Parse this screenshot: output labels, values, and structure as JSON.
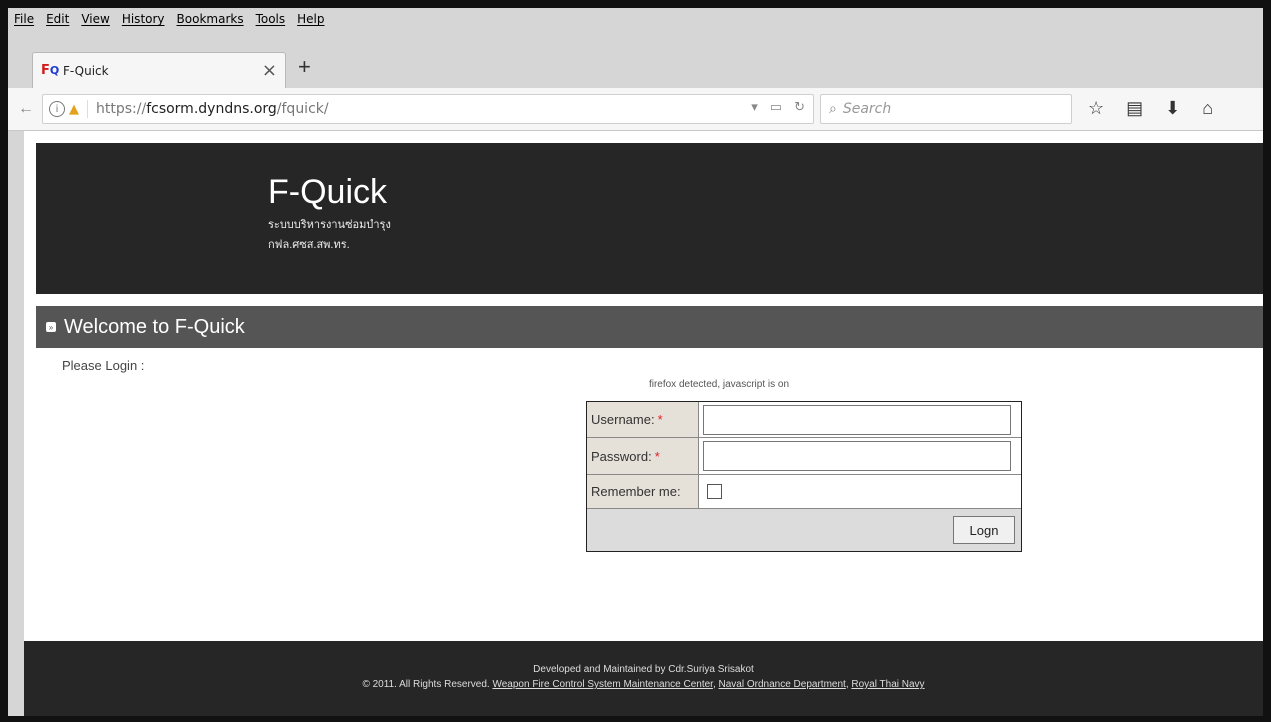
{
  "menu": [
    "File",
    "Edit",
    "View",
    "History",
    "Bookmarks",
    "Tools",
    "Help"
  ],
  "tab": {
    "title": "F-Quick",
    "favicon_text": "F",
    "favicon_q": "Q",
    "close_glyph": "×",
    "new_tab_glyph": "+"
  },
  "navbar": {
    "url_prefix": "https://",
    "url_domain": "fcsorm.dyndns.org",
    "url_path": "/fquick/",
    "search_placeholder": "Search"
  },
  "icons": {
    "back": "arrow-left-icon",
    "info": "info-icon",
    "lock": "warning-lock-icon",
    "reader": "reader-view-icon",
    "reload": "reload-icon",
    "search": "search-icon",
    "bookmark": "star-icon",
    "library": "library-icon",
    "download": "download-icon",
    "home": "home-icon"
  },
  "header": {
    "title": "F-Quick",
    "subtitle_line1": "ระบบบริหารงานซ่อมบำรุง",
    "subtitle_line2": "กฟล.ศซส.สพ.ทร."
  },
  "welcome": {
    "title": "Welcome to F-Quick"
  },
  "login": {
    "prompt": "Please Login :",
    "detected": "firefox detected, javascript is on",
    "username_label": "Username:",
    "password_label": "Password:",
    "remember_label": "Remember me:",
    "required_mark": "*",
    "username_value": "",
    "password_value": "",
    "login_button": "Logn"
  },
  "footer": {
    "line1": "Developed and Maintained by Cdr.Suriya Srisakot",
    "copyright": "© 2011. All Rights Reserved.",
    "link1": "Weapon Fire Control System Maintenance Center",
    "link2": "Naval Ordnance Department",
    "link3": "Royal Thai Navy"
  },
  "colors": {
    "header_bg": "#262626",
    "welcome_bg": "#555555",
    "label_bg": "#e5e0d8",
    "required": "#dd2222",
    "chrome_bg": "#d6d6d6"
  }
}
